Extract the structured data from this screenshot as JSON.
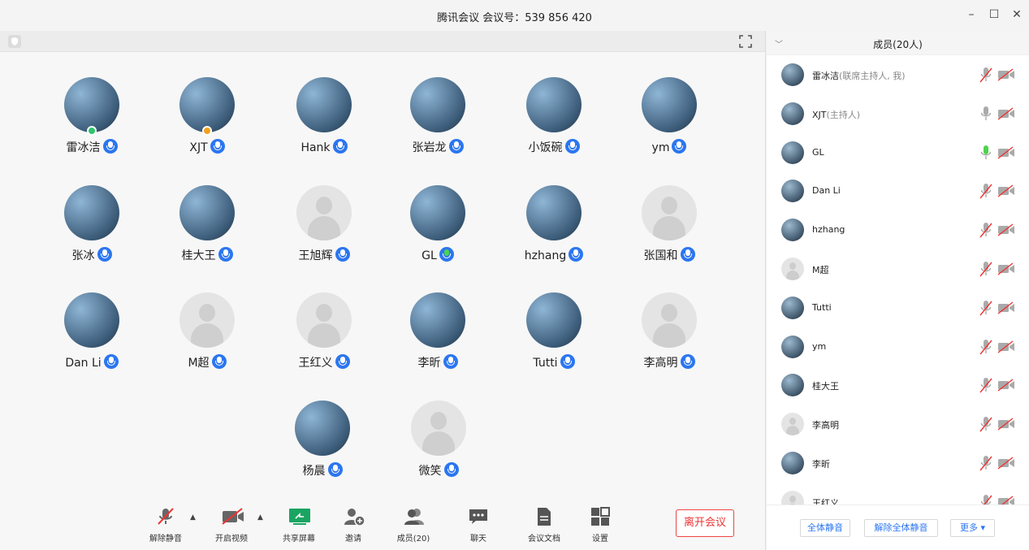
{
  "window": {
    "title": "腾讯会议 会议号：539 856 420",
    "minimize_icon": "minimize-icon",
    "maximize_icon": "maximize-icon",
    "close_icon": "close-icon"
  },
  "stage": {
    "shield_icon": "shield-icon",
    "fullscreen_icon": "fullscreen-icon"
  },
  "participants": [
    {
      "name": "雷冰洁",
      "photo": true,
      "badge": "#2ec46b",
      "mic": "blue"
    },
    {
      "name": "XJT",
      "photo": true,
      "badge": "#f0a020",
      "mic": "blue"
    },
    {
      "name": "Hank",
      "photo": true,
      "mic": "blue"
    },
    {
      "name": "张岩龙",
      "photo": true,
      "mic": "blue"
    },
    {
      "name": "小饭碗",
      "photo": true,
      "mic": "blue"
    },
    {
      "name": "ym",
      "photo": true,
      "mic": "blue"
    },
    {
      "name": "张冰",
      "photo": true,
      "mic": "blue"
    },
    {
      "name": "桂大王",
      "photo": true,
      "mic": "blue"
    },
    {
      "name": "王旭辉",
      "photo": false,
      "mic": "blue"
    },
    {
      "name": "GL",
      "photo": true,
      "mic": "green"
    },
    {
      "name": "hzhang",
      "photo": true,
      "mic": "blue"
    },
    {
      "name": "张国和",
      "photo": false,
      "mic": "blue"
    },
    {
      "name": "Dan Li",
      "photo": true,
      "mic": "blue"
    },
    {
      "name": "M超",
      "photo": false,
      "mic": "blue"
    },
    {
      "name": "王红义",
      "photo": false,
      "mic": "blue"
    },
    {
      "name": "李昕",
      "photo": true,
      "mic": "blue"
    },
    {
      "name": "Tutti",
      "photo": true,
      "mic": "blue"
    },
    {
      "name": "李高明",
      "photo": false,
      "mic": "blue"
    },
    {
      "name": "杨晨",
      "photo": true,
      "mic": "blue"
    },
    {
      "name": "微笑",
      "photo": false,
      "mic": "blue"
    }
  ],
  "toolbar": {
    "unmute": "解除静音",
    "start_video": "开启视频",
    "share_screen": "共享屏幕",
    "invite": "邀请",
    "members": "成员(20)",
    "chat": "聊天",
    "docs": "会议文档",
    "settings": "设置",
    "leave": "离开会议"
  },
  "panel": {
    "title": "成员(20人)",
    "members": [
      {
        "name": "雷冰洁",
        "role": "(联席主持人, 我)",
        "photo": true,
        "mic": "muted"
      },
      {
        "name": "XJT",
        "role": "(主持人)",
        "photo": true,
        "mic": "on"
      },
      {
        "name": "GL",
        "role": "",
        "photo": true,
        "mic": "speaking"
      },
      {
        "name": "Dan Li",
        "role": "",
        "photo": true,
        "mic": "muted"
      },
      {
        "name": "hzhang",
        "role": "",
        "photo": true,
        "mic": "muted"
      },
      {
        "name": "M超",
        "role": "",
        "photo": false,
        "mic": "muted"
      },
      {
        "name": "Tutti",
        "role": "",
        "photo": true,
        "mic": "muted"
      },
      {
        "name": "ym",
        "role": "",
        "photo": true,
        "mic": "muted"
      },
      {
        "name": "桂大王",
        "role": "",
        "photo": true,
        "mic": "muted"
      },
      {
        "name": "李高明",
        "role": "",
        "photo": false,
        "mic": "muted"
      },
      {
        "name": "李昕",
        "role": "",
        "photo": true,
        "mic": "muted"
      },
      {
        "name": "王红义",
        "role": "",
        "photo": false,
        "mic": "muted"
      }
    ],
    "mute_all": "全体静音",
    "unmute_all": "解除全体静音",
    "more": "更多 ▾"
  },
  "colors": {
    "accent": "#2b76f0",
    "danger": "#e33333",
    "speaking": "#4cd44c"
  }
}
